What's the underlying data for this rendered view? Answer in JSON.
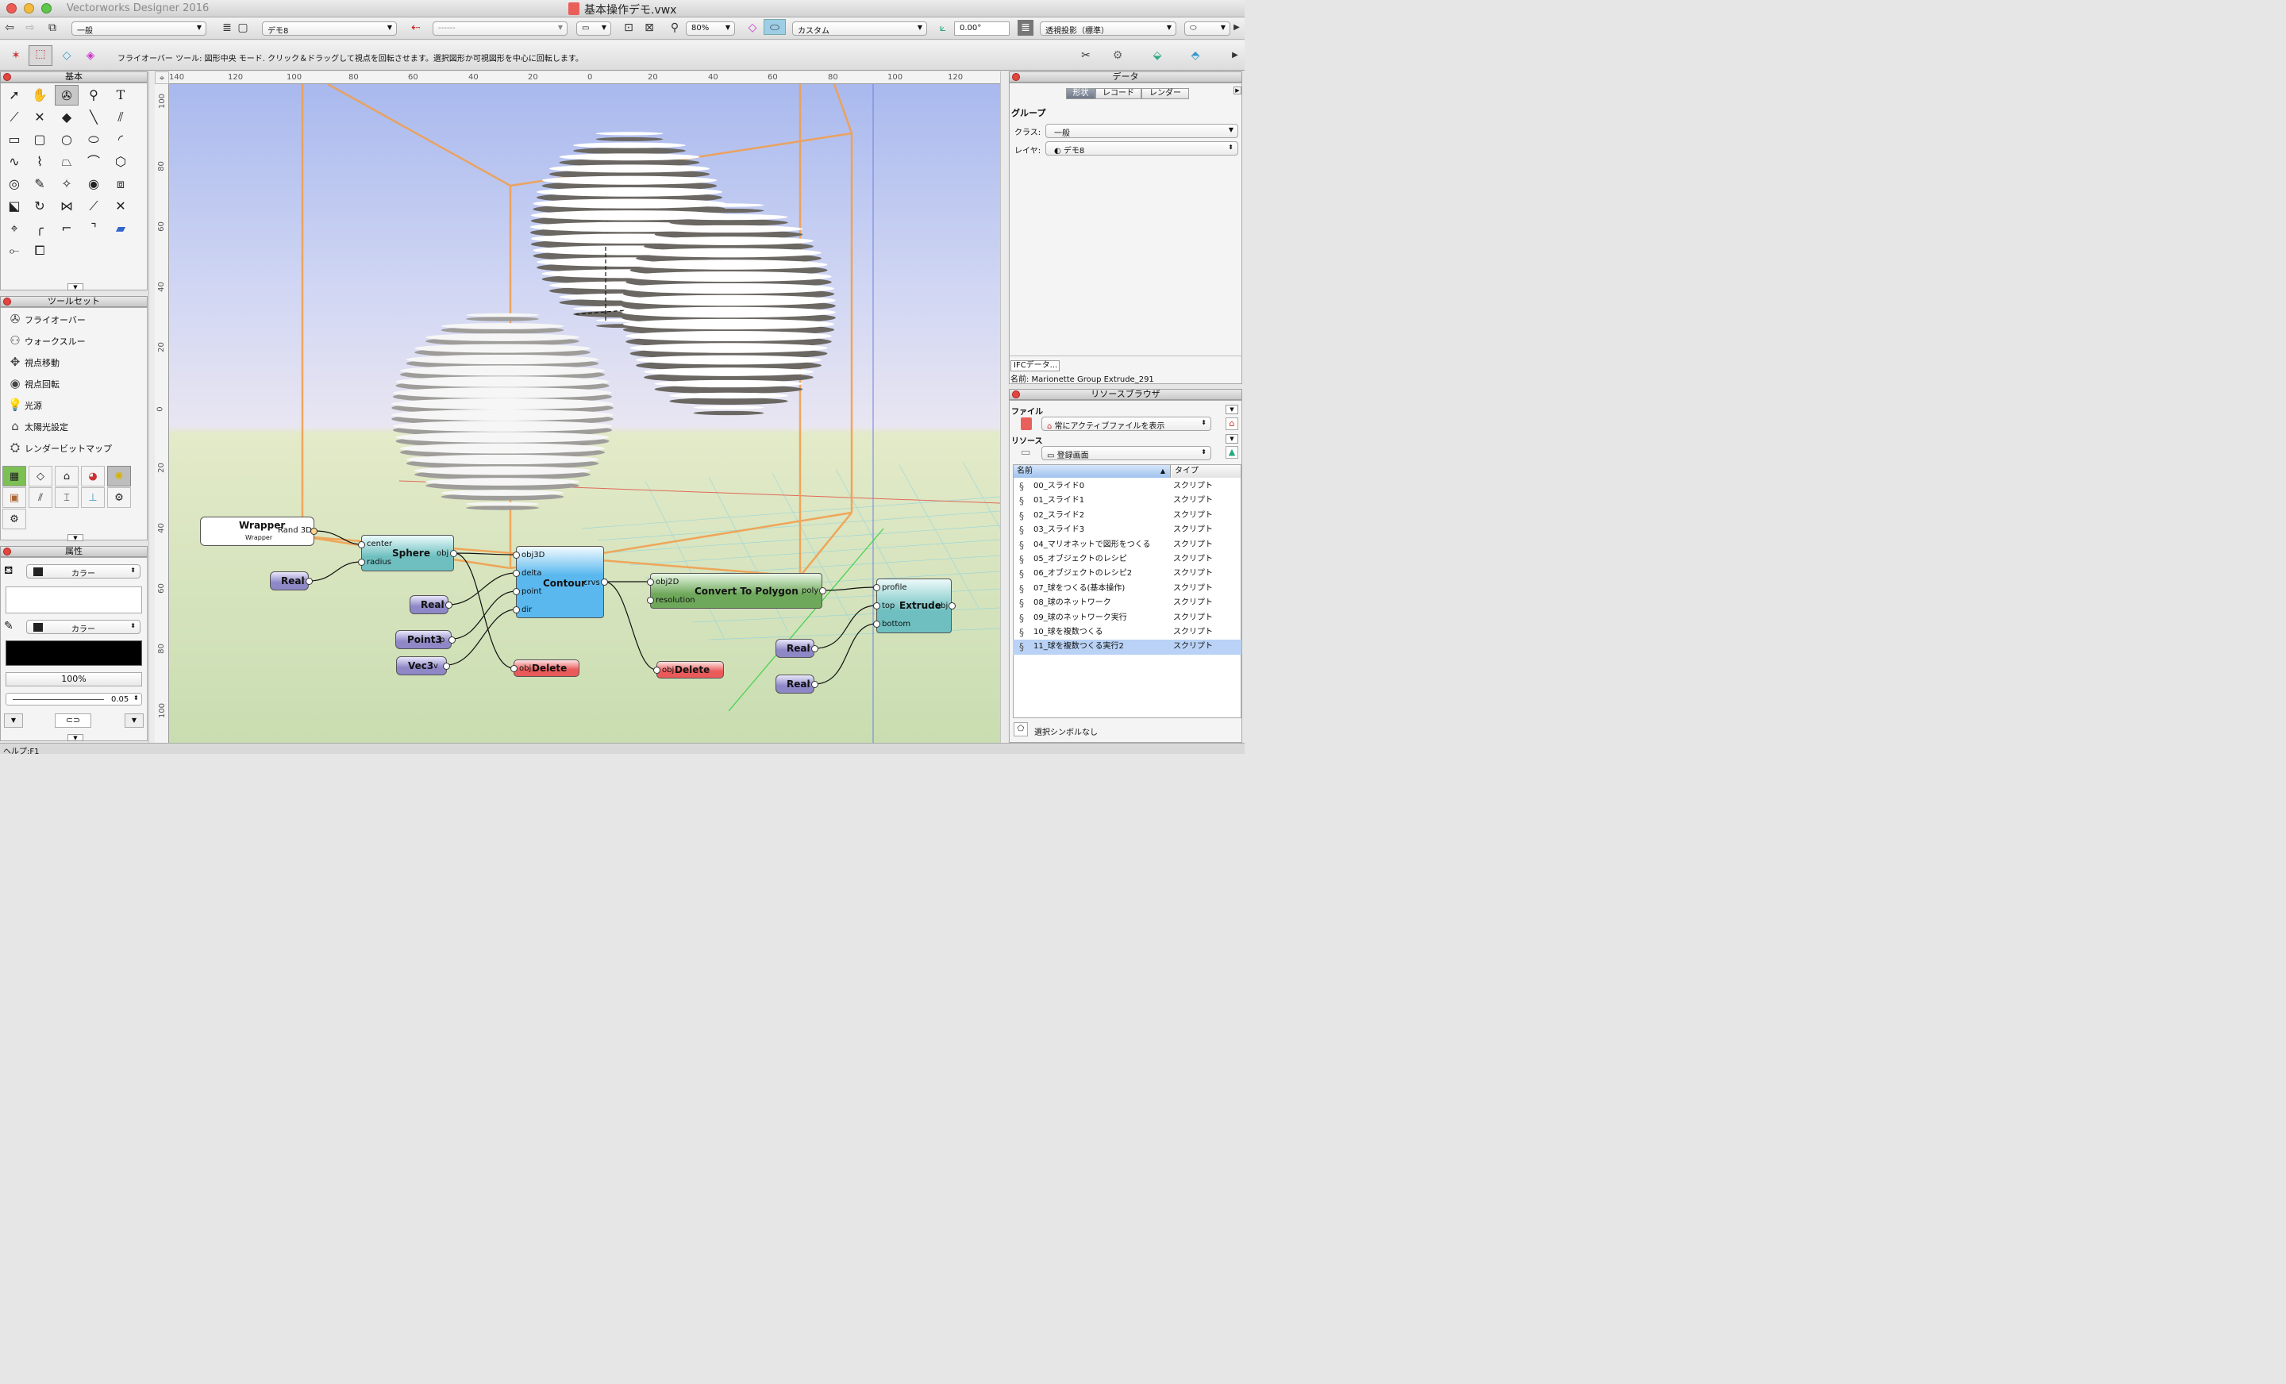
{
  "window": {
    "app_name": "Vectorworks Designer 2016",
    "document_title": "基本操作デモ.vwx"
  },
  "toolbar": {
    "class_value": "一般",
    "layer_value": "デモ8",
    "view_value": "------",
    "zoom_value": "80%",
    "render_value": "カスタム",
    "angle_value": "0.00°",
    "projection_value": "透視投影（標準）"
  },
  "mode_bar": {
    "help_text": "フライオーバー ツール: 図形中央 モード. クリック＆ドラッグして視点を回転させます。選択図形か可視図形を中心に回転します。"
  },
  "basic_palette": {
    "title": "基本"
  },
  "toolset_palette": {
    "title": "ツールセット",
    "items": [
      {
        "label": "フライオーバー",
        "icon": "flyover-icon"
      },
      {
        "label": "ウォークスルー",
        "icon": "walkthrough-icon"
      },
      {
        "label": "視点移動",
        "icon": "pan-view-icon"
      },
      {
        "label": "視点回転",
        "icon": "rotate-view-icon"
      },
      {
        "label": "光源",
        "icon": "light-icon"
      },
      {
        "label": "太陽光設定",
        "icon": "sun-icon"
      },
      {
        "label": "レンダービットマップ",
        "icon": "render-bitmap-icon"
      }
    ]
  },
  "attributes_palette": {
    "title": "属性",
    "fill_label": "カラー",
    "pen_label": "カラー",
    "opacity": "100%",
    "line_weight": "0.05"
  },
  "rulers": {
    "top": [
      "140",
      "120",
      "100",
      "80",
      "60",
      "40",
      "20",
      "0",
      "20",
      "40",
      "60",
      "80",
      "100",
      "120"
    ],
    "left": [
      "100",
      "80",
      "60",
      "40",
      "20",
      "0",
      "20",
      "40",
      "60",
      "80",
      "100"
    ]
  },
  "nodes": {
    "wrapper": {
      "title": "Wrapper",
      "subtitle": "Wrapper",
      "out": "Rand 3D"
    },
    "sphere": {
      "title": "Sphere",
      "in1": "center",
      "in2": "radius",
      "out": "obj"
    },
    "real1": {
      "title": "Real",
      "out": "r"
    },
    "real2": {
      "title": "Real",
      "out": "r"
    },
    "point3": {
      "title": "Point3",
      "out": "p"
    },
    "vec3": {
      "title": "Vec3",
      "out": "v"
    },
    "contour": {
      "title": "Contour",
      "in1": "obj3D",
      "in2": "delta",
      "in3": "point",
      "in4": "dir",
      "out": "crvs"
    },
    "delete1": {
      "title": "Delete",
      "in": "obj"
    },
    "delete2": {
      "title": "Delete",
      "in": "obj"
    },
    "convert": {
      "title": "Convert To Polygon",
      "in1": "obj2D",
      "in2": "resolution",
      "out": "poly"
    },
    "extrude": {
      "title": "Extrude",
      "in1": "profile",
      "in2": "top",
      "in3": "bottom",
      "out": "obj"
    },
    "real3": {
      "title": "Real",
      "out": "r"
    },
    "real4": {
      "title": "Real",
      "out": "r"
    }
  },
  "data_palette": {
    "title": "データ",
    "tabs": [
      "形状",
      "レコード",
      "レンダー"
    ],
    "section": "グループ",
    "class_label": "クラス:",
    "class_value": "一般",
    "layer_label": "レイヤ:",
    "layer_value": "デモ8",
    "ifc_button": "IFCデータ...",
    "name_line": "名前: Marionette Group Extrude_291"
  },
  "resource_browser": {
    "title": "リソースブラウザ",
    "file_label": "ファイル",
    "file_value": "常にアクティブファイルを表示",
    "resource_label": "リソース",
    "resource_value": "登録画面",
    "col_name": "名前",
    "col_type": "タイプ",
    "items": [
      {
        "name": "00_スライド0",
        "type": "スクリプト"
      },
      {
        "name": "01_スライド1",
        "type": "スクリプト"
      },
      {
        "name": "02_スライド2",
        "type": "スクリプト"
      },
      {
        "name": "03_スライド3",
        "type": "スクリプト"
      },
      {
        "name": "04_マリオネットで図形をつくる",
        "type": "スクリプト"
      },
      {
        "name": "05_オブジェクトのレシピ",
        "type": "スクリプト"
      },
      {
        "name": "06_オブジェクトのレシピ2",
        "type": "スクリプト"
      },
      {
        "name": "07_球をつくる(基本操作)",
        "type": "スクリプト"
      },
      {
        "name": "08_球のネットワーク",
        "type": "スクリプト"
      },
      {
        "name": "09_球のネットワーク実行",
        "type": "スクリプト"
      },
      {
        "name": "10_球を複数つくる",
        "type": "スクリプト"
      },
      {
        "name": "11_球を複数つくる実行2",
        "type": "スクリプト"
      }
    ],
    "selected_index": 11,
    "footer": "選択シンボルなし"
  },
  "status_bar": {
    "help": "ヘルプ:F1"
  },
  "colors": {
    "selection": "#b9d2f5",
    "node_sphere": "#6fbfc0",
    "node_contour": "#5ab8ee",
    "node_convert": "#6ea85a",
    "node_real": "#8e88c7",
    "node_delete": "#ea5a5a"
  }
}
